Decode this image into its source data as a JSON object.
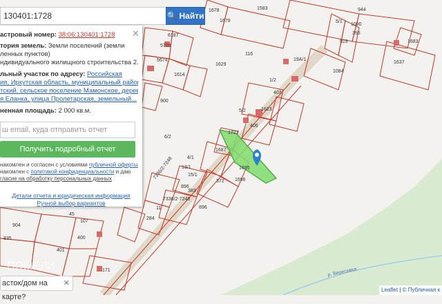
{
  "search": {
    "value": "130401:1728",
    "button_label": "Найти"
  },
  "panel": {
    "cadastral_label": "астровый номер:",
    "cadastral_value": "38:06:130401:1728",
    "category_label": "тория земель:",
    "category_value_1": "Земли поселений (земли",
    "category_value_2": "ленных пунктов)",
    "purpose": "ндивидуального жилищного строительства 2.11",
    "address_label": "льный участок по адресу:",
    "address_link_1": "Российская",
    "address_link_2": "ия, Иркутская область, муниципальный район",
    "address_link_3": "тский, сельское поселение Мамонское, деревня",
    "address_link_4": "я Еланка, улица Пролетарская, земельный...",
    "area_label": "ненная площадь:",
    "area_value": "2 000 кв.м.",
    "email_placeholder": "ш email, куда отправить отчет",
    "get_report": "Получить подробный отчет",
    "terms_1a": "накомлен и согласен с условиями",
    "terms_1b": "публичной оферты",
    "terms_2a": "накомлен с",
    "terms_2b": "политикой конфиденциальности",
    "terms_2c": "и даю",
    "terms_3": "гласие на обработку персональных данных",
    "details_link": "Детали отчета и юридическая информация",
    "manual_link": "Ручной выбор вариантов"
  },
  "ask_button": "асток/дом на карте?",
  "attribution": {
    "leaflet": "Leaflet",
    "sep": "|",
    "pub": "© Публичная к"
  },
  "map": {
    "road_label": "7336/2-7248",
    "river_label": "р. Вересовка",
    "plots": [
      "1583",
      "1678",
      "1679",
      "944",
      "5/1",
      "1090",
      "395",
      "919",
      "1683",
      "1637",
      "6187",
      "5709",
      "116",
      "19А/1",
      "1084",
      "5674",
      "1614",
      "1629",
      "403",
      "900",
      "1623",
      "406",
      "1/2",
      "1727",
      "1687",
      "1695",
      "1696",
      "372",
      "383",
      "896",
      "896",
      "7336/2-7248",
      "284",
      "6/2",
      "904",
      "835",
      "107",
      "400",
      "401",
      "171",
      "45",
      "11",
      "4/1",
      "13/1",
      "15/1",
      "5/2"
    ],
    "watermark": "ПОМЕЛИ"
  }
}
